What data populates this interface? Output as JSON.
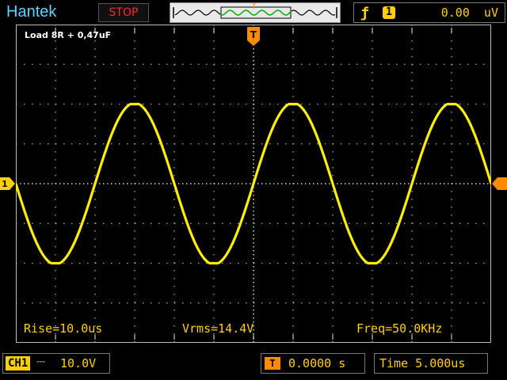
{
  "brand": "Hantek",
  "run_state": "STOP",
  "trigger_panel": {
    "edge_icon": "rising-edge-icon",
    "channel": "1",
    "level": "0.00  uV"
  },
  "screen": {
    "note": "Load 8R + 0,47uF",
    "trigger_marker": "T",
    "ch1_marker_left": "1",
    "grid_divisions": {
      "horizontal": 12,
      "vertical": 8
    },
    "waveform": {
      "cycles": 3,
      "amplitude_divisions": 2,
      "color": "#ffee00"
    }
  },
  "measurements": {
    "rise": "Rise=10.0us",
    "vrms": "Vrms=14.4V",
    "freq": "Freq=50.0KHz"
  },
  "bottom": {
    "channel": "CH1",
    "coupling_icon": "dc-coupling-icon",
    "vdiv": "10.0V",
    "trigger_pos_icon": "T",
    "trigger_pos": "0.0000 s",
    "timebase": "Time 5.000us"
  },
  "colors": {
    "trace": "#ffee00",
    "accent": "#ff8c00",
    "brand": "#5fd3ff",
    "stop": "#ff2a2a"
  }
}
